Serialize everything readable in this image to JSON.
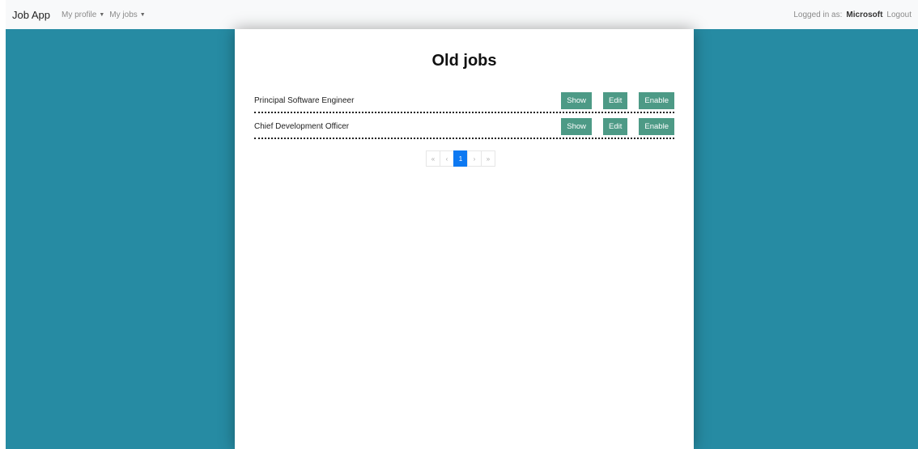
{
  "navbar": {
    "brand": "Job App",
    "menus": [
      {
        "label": "My profile"
      },
      {
        "label": "My jobs"
      }
    ],
    "logged_in_label": "Logged in as:",
    "username": "Microsoft",
    "logout_label": "Logout"
  },
  "main": {
    "title": "Old jobs",
    "jobs": [
      {
        "title": "Principal Software Engineer",
        "show": "Show",
        "edit": "Edit",
        "enable": "Enable"
      },
      {
        "title": "Chief Development Officer",
        "show": "Show",
        "edit": "Edit",
        "enable": "Enable"
      }
    ],
    "pagination": {
      "first": "«",
      "prev": "‹",
      "current": "1",
      "next": "›",
      "last": "»"
    }
  },
  "colors": {
    "background": "#268ba3",
    "button": "#4d9a86",
    "active_page": "#0d79f2"
  }
}
